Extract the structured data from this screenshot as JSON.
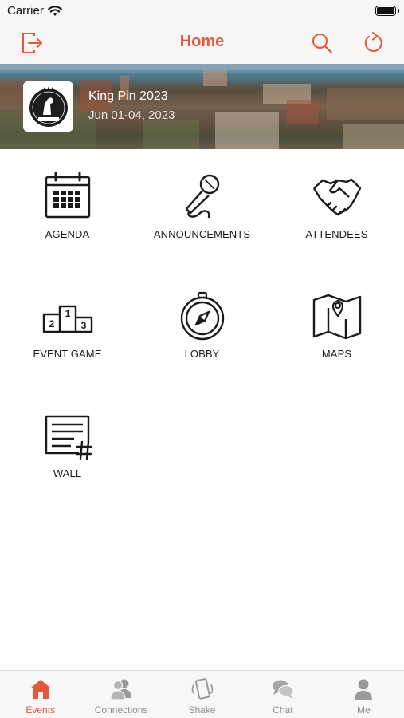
{
  "status_bar": {
    "carrier": "Carrier"
  },
  "nav": {
    "title": "Home"
  },
  "event": {
    "name": "King Pin 2023",
    "dates": "Jun 01-04, 2023",
    "logo_text": "KING PIN"
  },
  "tiles": [
    {
      "label": "AGENDA",
      "icon": "calendar-icon"
    },
    {
      "label": "ANNOUNCEMENTS",
      "icon": "microphone-icon"
    },
    {
      "label": "ATTENDEES",
      "icon": "handshake-icon"
    },
    {
      "label": "EVENT GAME",
      "icon": "podium-icon"
    },
    {
      "label": "LOBBY",
      "icon": "compass-icon"
    },
    {
      "label": "MAPS",
      "icon": "map-icon"
    },
    {
      "label": "WALL",
      "icon": "wall-post-icon"
    }
  ],
  "tabs": [
    {
      "label": "Events",
      "icon": "home-icon",
      "active": true
    },
    {
      "label": "Connections",
      "icon": "people-icon",
      "active": false
    },
    {
      "label": "Shake",
      "icon": "phone-shake-icon",
      "active": false
    },
    {
      "label": "Chat",
      "icon": "chat-bubbles-icon",
      "active": false
    },
    {
      "label": "Me",
      "icon": "person-icon",
      "active": false
    }
  ],
  "colors": {
    "accent": "#e1583c",
    "tab_inactive": "#8e8e8e",
    "icon_stroke": "#1a1a1a"
  }
}
